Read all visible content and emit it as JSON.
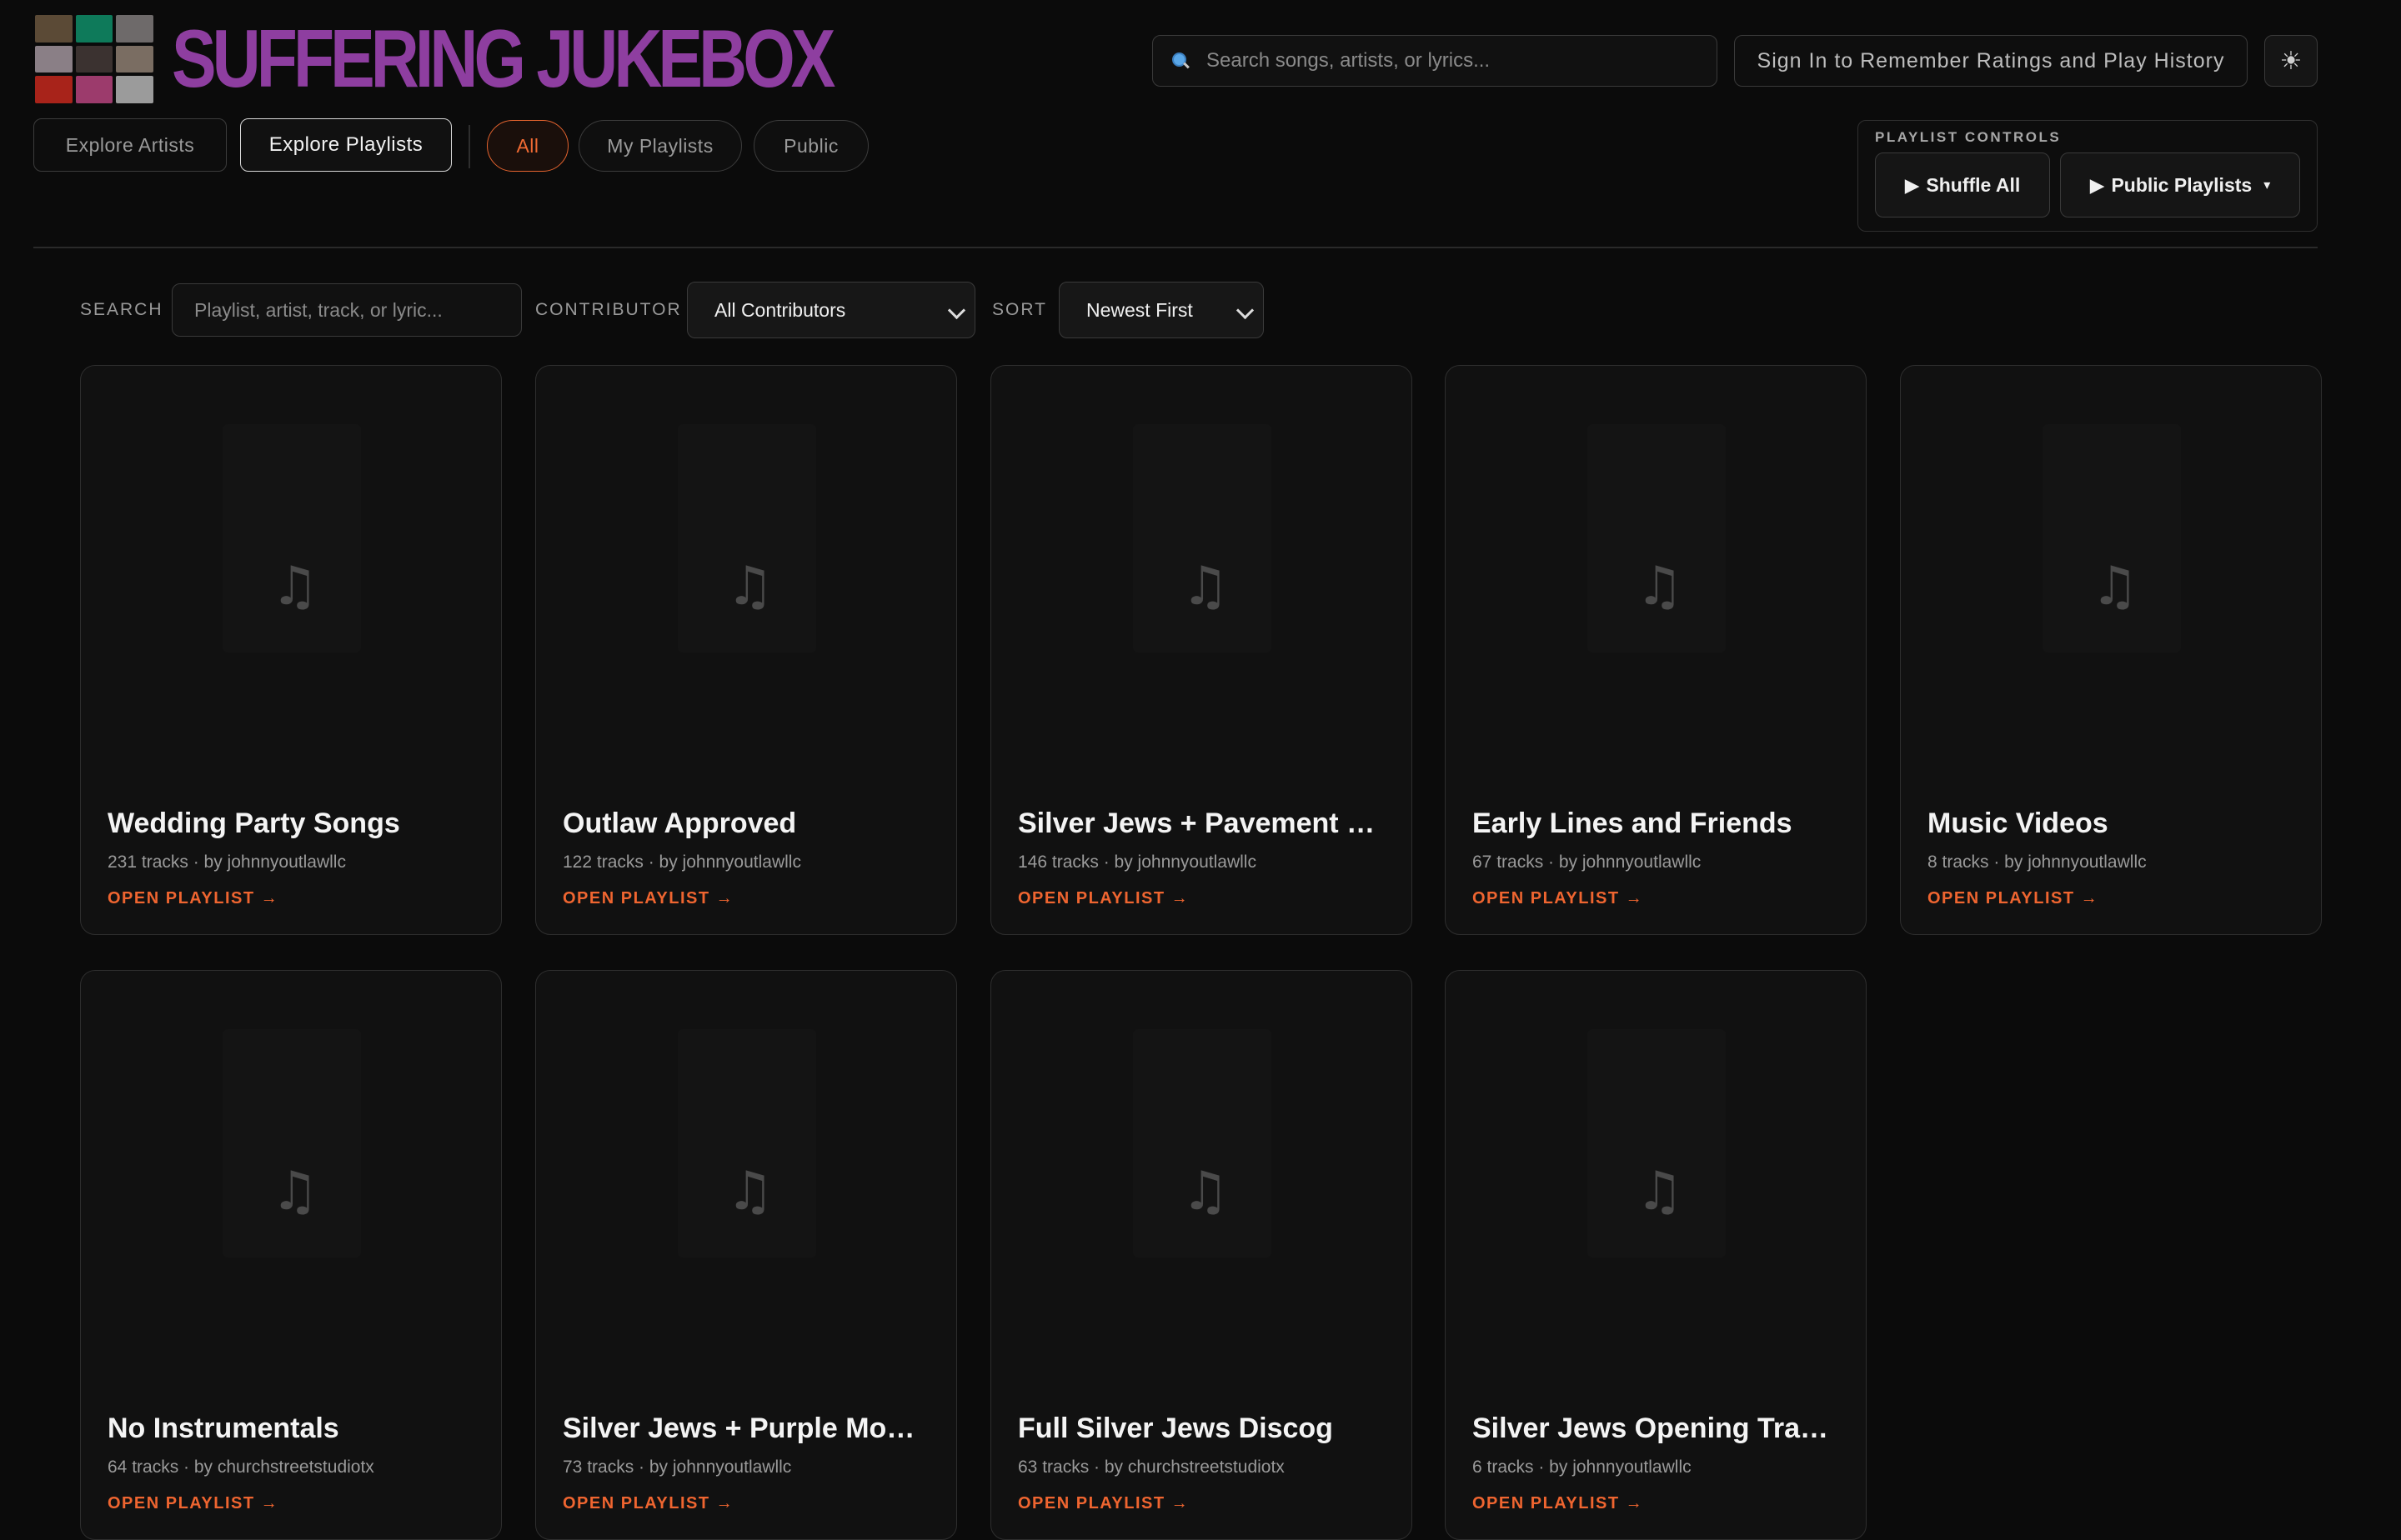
{
  "app": {
    "title": "SUFFERING JUKEBOX"
  },
  "logo_tiles": [
    "#5b4a36",
    "#0e7a5a",
    "#6e6a6a",
    "#8a7f86",
    "#3b3230",
    "#7a6d62",
    "#a8231a",
    "#9c3b6c",
    "#9b9b9b"
  ],
  "header": {
    "search_placeholder": "Search songs, artists, or lyrics...",
    "signin_label": "Sign In to Remember Ratings and Play History",
    "theme_icon": "☀"
  },
  "tabs": [
    {
      "label": "Explore Artists",
      "active": false
    },
    {
      "label": "Explore Playlists",
      "active": true
    }
  ],
  "filters": [
    {
      "label": "All",
      "active": true
    },
    {
      "label": "My Playlists",
      "active": false
    },
    {
      "label": "Public",
      "active": false
    }
  ],
  "controls": {
    "caption": "PLAYLIST CONTROLS",
    "shuffle_label": "Shuffle All",
    "public_label": "Public Playlists",
    "play_icon": "▶",
    "caret_icon": "▾"
  },
  "filterbar": {
    "search_label": "SEARCH",
    "search_placeholder": "Playlist, artist, track, or lyric...",
    "contributor_label": "CONTRIBUTOR",
    "contributor_value": "All Contributors",
    "sort_label": "SORT",
    "sort_value": "Newest First"
  },
  "playlists": [
    {
      "title": "Wedding Party Songs",
      "meta": "231 tracks · by johnnyoutlawllc",
      "cta": "OPEN PLAYLIST →"
    },
    {
      "title": "Outlaw Approved",
      "meta": "122 tracks · by johnnyoutlawllc",
      "cta": "OPEN PLAYLIST →"
    },
    {
      "title": "Silver Jews + Pavement …",
      "meta": "146 tracks · by johnnyoutlawllc",
      "cta": "OPEN PLAYLIST →"
    },
    {
      "title": "Early Lines and Friends",
      "meta": "67 tracks · by johnnyoutlawllc",
      "cta": "OPEN PLAYLIST →"
    },
    {
      "title": "Music Videos",
      "meta": "8 tracks · by johnnyoutlawllc",
      "cta": "OPEN PLAYLIST →"
    },
    {
      "title": "No Instrumentals",
      "meta": "64 tracks · by churchstreetstudiotx",
      "cta": "OPEN PLAYLIST →"
    },
    {
      "title": "Silver Jews + Purple Mo…",
      "meta": "73 tracks · by johnnyoutlawllc",
      "cta": "OPEN PLAYLIST →"
    },
    {
      "title": "Full Silver Jews Discog",
      "meta": "63 tracks · by churchstreetstudiotx",
      "cta": "OPEN PLAYLIST →"
    },
    {
      "title": "Silver Jews Opening Tra…",
      "meta": "6 tracks · by johnnyoutlawllc",
      "cta": "OPEN PLAYLIST →"
    }
  ],
  "colors": {
    "brand": "#8e3ea0",
    "accent": "#ef6530",
    "background": "#0b0b0b"
  },
  "icons": {
    "search": "search-icon",
    "theme": "sun-icon",
    "card_art": "music-note-icon",
    "note_glyph": "♫"
  }
}
